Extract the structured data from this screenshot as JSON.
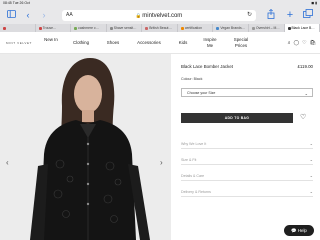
{
  "status": {
    "time": "08:45",
    "date": "Tue 26 Oct",
    "battery": "◼ ▮"
  },
  "browser": {
    "url": "mintvelvet.com",
    "aa_label": "AA",
    "tabs": [
      "",
      "Trouse…",
      "cashmere c…",
      "Shave sensit…",
      "British Beaut…",
      "certification",
      "Vegan Brands…",
      "Overshirt – M…",
      "Black Lace B…"
    ]
  },
  "site": {
    "logo": "MINT VELVET",
    "nav": [
      "New In",
      "Clothing",
      "Shoes",
      "Accessories",
      "Kids",
      "Inspire Me",
      "Special Prices"
    ]
  },
  "product": {
    "title": "Black Lace Bomber Jacket",
    "price": "£119.00",
    "colour": "Colour: Black",
    "size_placeholder": "Choose your Size",
    "add_to_bag": "ADD TO BAG",
    "accordions": [
      "Why We Love It",
      "Size & Fit",
      "Details & Care",
      "Delivery & Returns"
    ]
  },
  "help": {
    "label": "Help"
  }
}
